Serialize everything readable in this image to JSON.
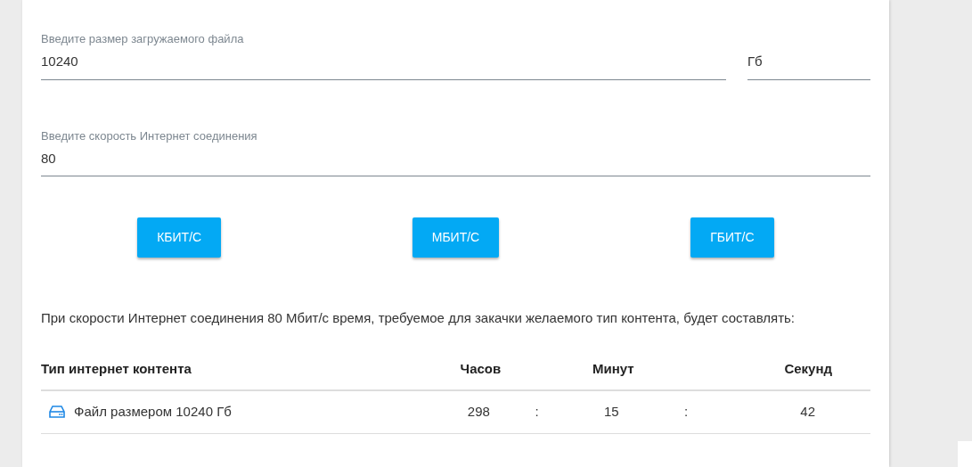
{
  "file_size": {
    "label": "Введите размер загружаемого файла",
    "value": "10240",
    "unit": "Гб"
  },
  "speed": {
    "label": "Введите скорость Интернет соединения",
    "value": "80"
  },
  "unit_buttons": [
    "КБИТ/С",
    "МБИТ/С",
    "ГБИТ/С"
  ],
  "result_text": "При скорости Интернет соединения 80 Мбит/с время, требуемое для закачки желаемого тип контента, будет составлять:",
  "table": {
    "columns": [
      "Тип интернет контента",
      "Часов",
      "Минут",
      "Секунд"
    ],
    "rows": [
      {
        "type": "Файл размером 10240 Гб",
        "hours": "298",
        "sep1": ":",
        "minutes": "15",
        "sep2": ":",
        "seconds": "42"
      }
    ]
  }
}
